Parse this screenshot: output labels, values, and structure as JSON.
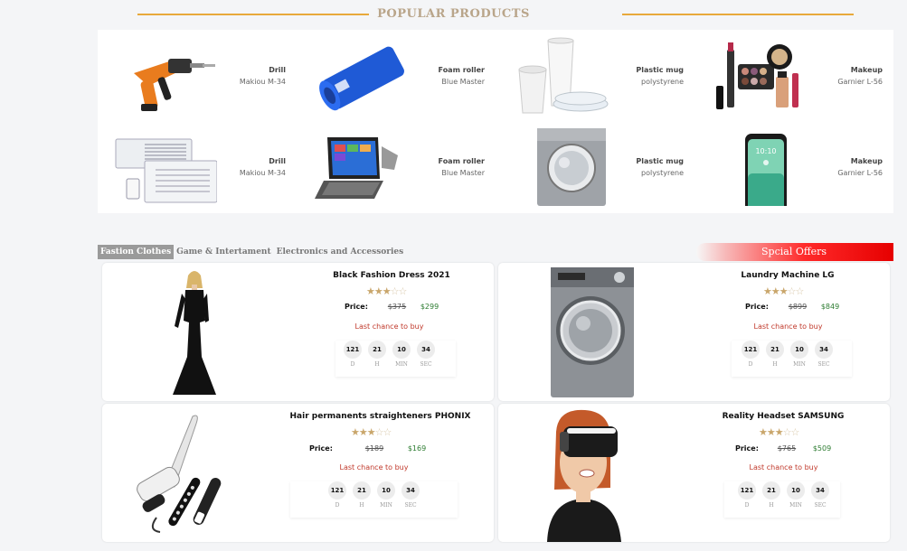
{
  "popular": {
    "title": "POPULAR PRODUCTS",
    "items": [
      {
        "name": "Drill",
        "sub": "Makiou M-34"
      },
      {
        "name": "Foam roller",
        "sub": "Blue Master"
      },
      {
        "name": "Plastic mug",
        "sub": "polystyrene"
      },
      {
        "name": "Makeup",
        "sub": "Garnier L-56"
      },
      {
        "name": "Drill",
        "sub": "Makiou M-34"
      },
      {
        "name": "Foam roller",
        "sub": "Blue Master"
      },
      {
        "name": "Plastic mug",
        "sub": "polystyrene"
      },
      {
        "name": "Makeup",
        "sub": "Garnier L-56"
      }
    ]
  },
  "tabs": [
    "Fastion Clothes",
    "Game & Intertament",
    "Electronics and Accessories"
  ],
  "offer_banner": "Spcial Offers",
  "cards": [
    {
      "title": "Black Fashion Dress 2021",
      "rating": 3,
      "price_label": "Price:",
      "old_price": "$375",
      "new_price": "$299",
      "last_chance": "Last chance to buy",
      "countdown": [
        "121",
        "21",
        "10",
        "34"
      ]
    },
    {
      "title": "Laundry Machine LG",
      "rating": 3,
      "price_label": "Price:",
      "old_price": "$899",
      "new_price": "$849",
      "last_chance": "Last chance to buy",
      "countdown": [
        "121",
        "21",
        "10",
        "34"
      ]
    },
    {
      "title": "Hair permanents straighteners PHONIX",
      "rating": 3,
      "price_label": "Price:",
      "old_price": "$189",
      "new_price": "$169",
      "last_chance": "Last chance to buy",
      "countdown": [
        "121",
        "21",
        "10",
        "34"
      ]
    },
    {
      "title": "Reality Headset SAMSUNG",
      "rating": 3,
      "price_label": "Price:",
      "old_price": "$765",
      "new_price": "$509",
      "last_chance": "Last chance to buy",
      "countdown": [
        "121",
        "21",
        "10",
        "34"
      ]
    }
  ],
  "countdown_labels": [
    "D",
    "H",
    "MIN",
    "SEC"
  ],
  "phone_time": "10:10",
  "colors": {
    "accent_line": "#e8a93b",
    "offer_red": "#ff2a2a",
    "new_price": "#2e7d32",
    "last_chance": "#c0392b"
  }
}
